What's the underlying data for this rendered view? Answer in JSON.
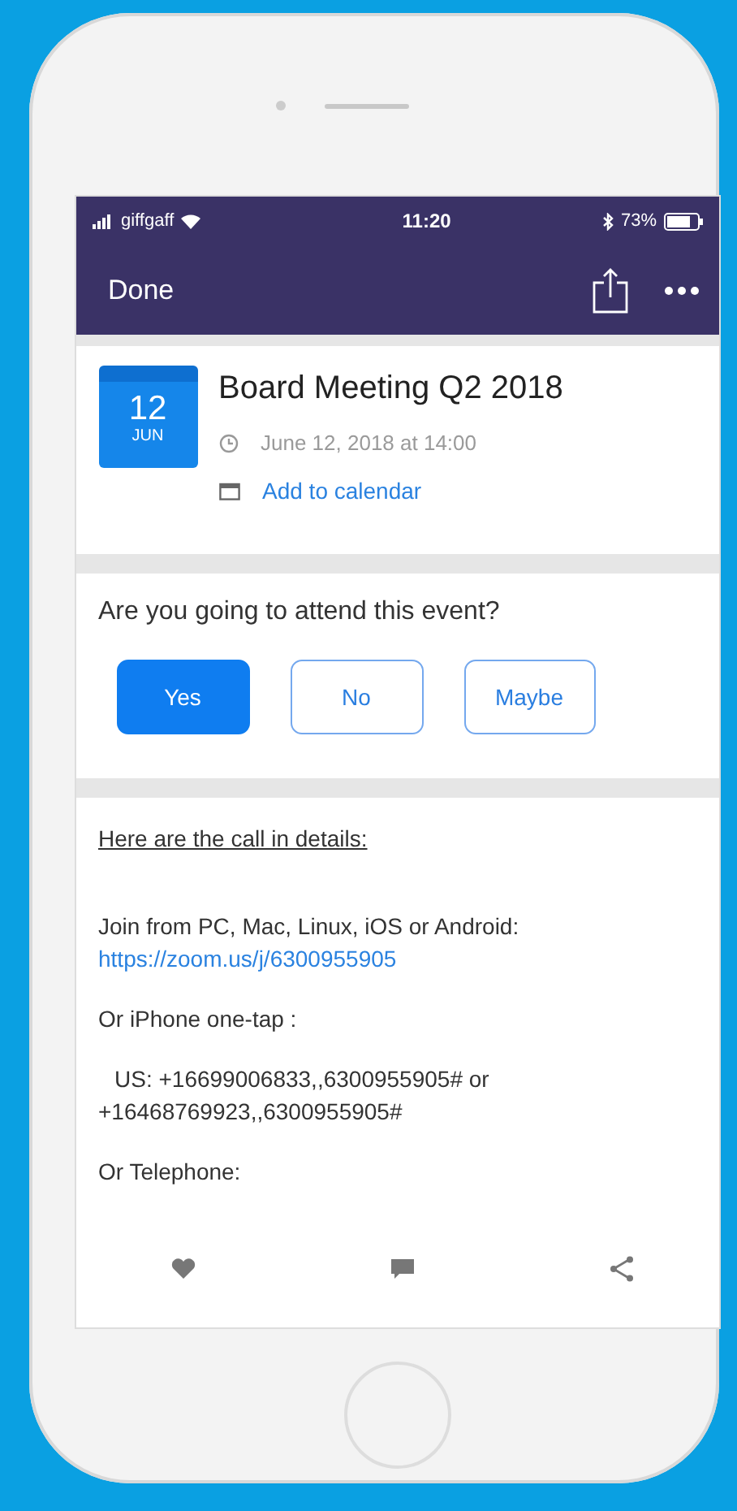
{
  "status_bar": {
    "carrier": "giffgaff",
    "time": "11:20",
    "battery": "73%"
  },
  "nav_bar": {
    "back": "Done"
  },
  "event": {
    "day": "12",
    "month": "JUN",
    "title": "Board Meeting Q2 2018",
    "datetime": "June 12, 2018 at 14:00",
    "add_to_calendar": "Add to calendar"
  },
  "rsvp": {
    "question": "Are you going to attend this event?",
    "options": [
      {
        "label": "Yes",
        "selected": true
      },
      {
        "label": "No",
        "selected": false
      },
      {
        "label": "Maybe",
        "selected": false
      }
    ]
  },
  "details": {
    "heading": "Here are the call in details:",
    "paragraphs": [
      {
        "text": "Join from PC, Mac, Linux, iOS or Android:",
        "link": "https://zoom.us/j/6300955905"
      },
      {
        "text": "Or iPhone one-tap :"
      },
      {
        "text": "US: +16699006833,,6300955905#  or +16468769923,,6300955905#",
        "indent": true
      },
      {
        "text": "Or Telephone:"
      }
    ]
  }
}
